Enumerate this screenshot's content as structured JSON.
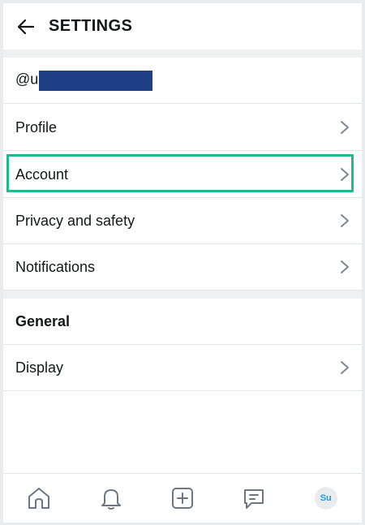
{
  "header": {
    "title": "SETTINGS",
    "back_icon": "arrow-left-icon"
  },
  "user": {
    "handle_prefix": "@u",
    "handle_redacted": true
  },
  "menu": {
    "profile": "Profile",
    "account": "Account",
    "privacy": "Privacy and safety",
    "notifications": "Notifications"
  },
  "general": {
    "heading": "General",
    "display": "Display"
  },
  "highlight": {
    "target": "account",
    "color": "#1fb991"
  },
  "bottom_nav": {
    "items": [
      "home-icon",
      "bell-icon",
      "compose-icon",
      "messages-icon",
      "avatar"
    ],
    "avatar_initials": "Su"
  },
  "colors": {
    "redaction": "#1e3f86",
    "accent": "#1d9bf0"
  }
}
